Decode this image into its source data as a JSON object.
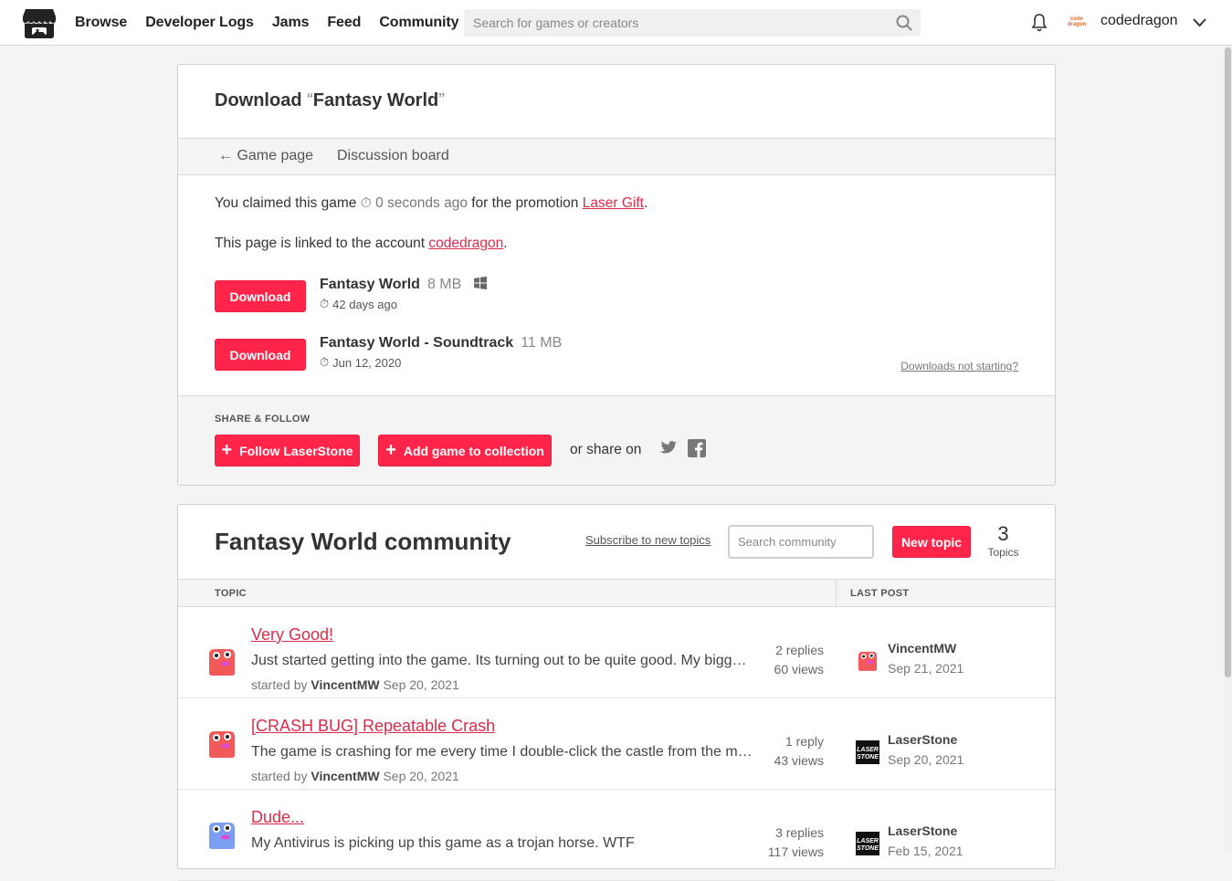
{
  "header": {
    "nav": [
      "Browse",
      "Developer Logs",
      "Jams",
      "Feed",
      "Community"
    ],
    "search_placeholder": "Search for games or creators",
    "avatar_text": "code dragon",
    "username": "codedragon"
  },
  "download": {
    "title_prefix": "Download",
    "title_game": "Fantasy World",
    "tabs": {
      "back": "Game page",
      "discussion": "Discussion board"
    },
    "claim": {
      "before": "You claimed this game",
      "time": "0 seconds ago",
      "middle": "for the promotion",
      "promo": "Laser Gift",
      "end": "."
    },
    "linked": {
      "before": "This page is linked to the account",
      "account": "codedragon",
      "end": "."
    },
    "files": [
      {
        "button": "Download",
        "name": "Fantasy World",
        "size": "8 MB",
        "date": "42 days ago"
      },
      {
        "button": "Download",
        "name": "Fantasy World - Soundtrack",
        "size": "11 MB",
        "date": "Jun 12, 2020"
      }
    ],
    "downloads_not_starting": "Downloads not starting?",
    "share": {
      "label": "SHARE & FOLLOW",
      "follow": "Follow LaserStone",
      "add": "Add game to collection",
      "or_share": "or share on"
    }
  },
  "community": {
    "title": "Fantasy World community",
    "subscribe": "Subscribe to new topics",
    "search_placeholder": "Search community",
    "new_topic": "New topic",
    "topic_count": "3",
    "topic_count_label": "Topics",
    "headers": {
      "topic": "TOPIC",
      "last_post": "LAST POST"
    },
    "topics": [
      {
        "title": "Very Good!",
        "snippet": "Just started getting into the game. Its turning out to be quite good. My biggest complaint so far is",
        "started_by": "started by",
        "author": "VincentMW",
        "date": "Sep 20, 2021",
        "replies": "2 replies",
        "views": "60 views",
        "last_user": "VincentMW",
        "last_date": "Sep 21, 2021"
      },
      {
        "title": "[CRASH BUG] Repeatable Crash",
        "snippet": "The game is crashing for me every time I double-click the castle from the main menu",
        "started_by": "started by",
        "author": "VincentMW",
        "date": "Sep 20, 2021",
        "replies": "1 reply",
        "views": "43 views",
        "last_user": "LaserStone",
        "last_date": "Sep 20, 2021"
      },
      {
        "title": "Dude...",
        "snippet": "My Antivirus is picking up this game as a trojan horse. WTF",
        "started_by": "",
        "author": "",
        "date": "",
        "replies": "3 replies",
        "views": "117 views",
        "last_user": "LaserStone",
        "last_date": "Feb 15, 2021"
      }
    ]
  }
}
